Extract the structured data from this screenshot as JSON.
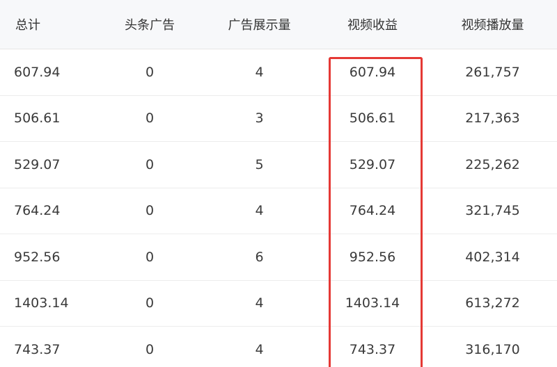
{
  "table": {
    "columns": [
      "总计",
      "头条广告",
      "广告展示量",
      "视频收益",
      "视频播放量"
    ],
    "rows": [
      [
        "607.94",
        "0",
        "4",
        "607.94",
        "261,757"
      ],
      [
        "506.61",
        "0",
        "3",
        "506.61",
        "217,363"
      ],
      [
        "529.07",
        "0",
        "5",
        "529.07",
        "225,262"
      ],
      [
        "764.24",
        "0",
        "4",
        "764.24",
        "321,745"
      ],
      [
        "952.56",
        "0",
        "6",
        "952.56",
        "402,314"
      ],
      [
        "1403.14",
        "0",
        "4",
        "1403.14",
        "613,272"
      ],
      [
        "743.37",
        "0",
        "4",
        "743.37",
        "316,170"
      ]
    ]
  },
  "colors": {
    "highlight_border": "#e53935",
    "header_bg": "#f7f8fa"
  }
}
